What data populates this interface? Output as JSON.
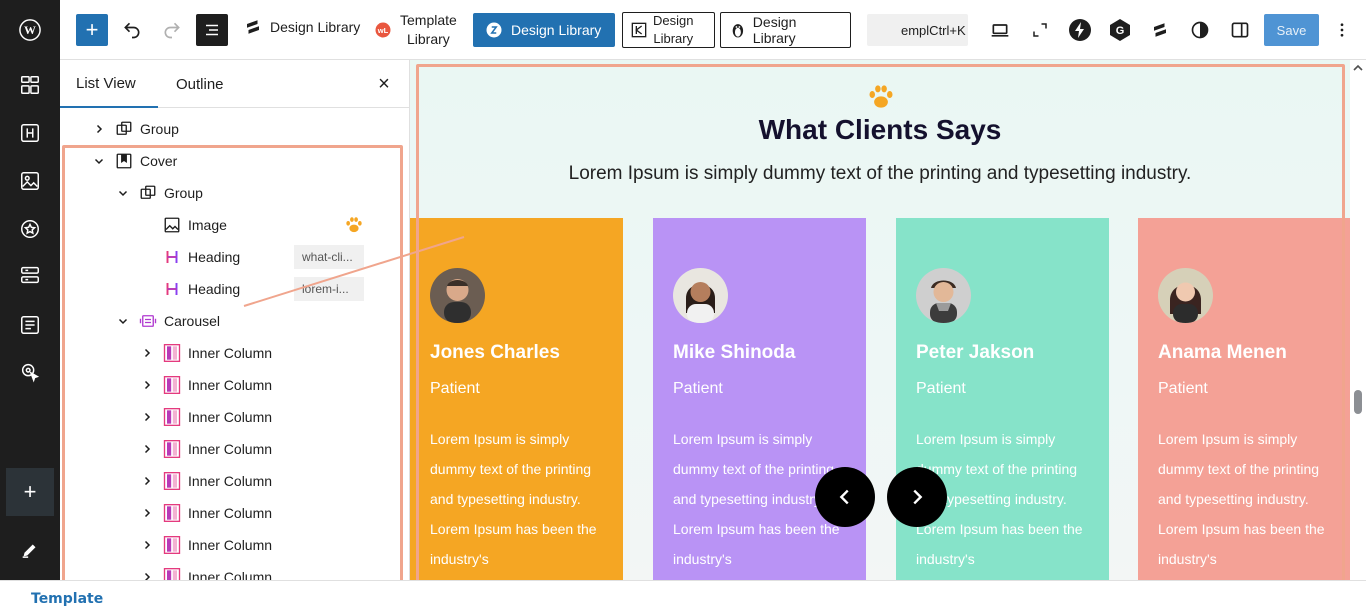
{
  "toolbar": {
    "plugin_1": "Design Library",
    "plugin_2_line1": "Template",
    "plugin_2_line2": "Library",
    "plugin_3": "Design Library",
    "plugin_4_line1": "Design",
    "plugin_4_line2": "Library",
    "plugin_5": "Design Library",
    "search_text": "emplCtrl+K",
    "save_label": "Save"
  },
  "panel": {
    "tabs": [
      "List View",
      "Outline"
    ],
    "close_icon": "close-icon",
    "tree": [
      {
        "label": "Group",
        "icon": "group-icon",
        "depth": 0,
        "chevron": "right"
      },
      {
        "label": "Cover",
        "icon": "cover-icon",
        "depth": 0,
        "chevron": "down"
      },
      {
        "label": "Group",
        "icon": "group-icon",
        "depth": 1,
        "chevron": "down"
      },
      {
        "label": "Image",
        "icon": "image-icon",
        "depth": 2,
        "chevron": "none"
      },
      {
        "label": "Heading",
        "icon": "heading-icon",
        "depth": 2,
        "chevron": "none",
        "anchor": "what-cli..."
      },
      {
        "label": "Heading",
        "icon": "heading-icon",
        "depth": 2,
        "chevron": "none",
        "anchor": "lorem-i..."
      },
      {
        "label": "Carousel",
        "icon": "carousel-icon",
        "depth": 1,
        "chevron": "down"
      },
      {
        "label": "Inner Column",
        "icon": "column-icon",
        "depth": 2,
        "chevron": "right"
      },
      {
        "label": "Inner Column",
        "icon": "column-icon",
        "depth": 2,
        "chevron": "right"
      },
      {
        "label": "Inner Column",
        "icon": "column-icon",
        "depth": 2,
        "chevron": "right"
      },
      {
        "label": "Inner Column",
        "icon": "column-icon",
        "depth": 2,
        "chevron": "right"
      },
      {
        "label": "Inner Column",
        "icon": "column-icon",
        "depth": 2,
        "chevron": "right"
      },
      {
        "label": "Inner Column",
        "icon": "column-icon",
        "depth": 2,
        "chevron": "right"
      },
      {
        "label": "Inner Column",
        "icon": "column-icon",
        "depth": 2,
        "chevron": "right"
      },
      {
        "label": "Inner Column",
        "icon": "column-icon",
        "depth": 2,
        "chevron": "right"
      }
    ]
  },
  "canvas": {
    "title": "What Clients Says",
    "subtitle": "Lorem Ipsum is simply dummy text of the printing and typesetting industry.",
    "cards": [
      {
        "name": "Jones Charles",
        "role": "Patient",
        "text": "Lorem Ipsum is simply dummy text of the printing and typesetting industry. Lorem Ipsum has been the industry's",
        "color": "#f5a623"
      },
      {
        "name": "Mike Shinoda",
        "role": "Patient",
        "text": "Lorem Ipsum is simply dummy text of the printing and typesetting industry. Lorem Ipsum has been the industry's",
        "color": "#b993f5"
      },
      {
        "name": "Peter Jakson",
        "role": "Patient",
        "text": "Lorem Ipsum is simply dummy text of the printing and typesetting industry. Lorem Ipsum has been the industry's",
        "color": "#86e3c9"
      },
      {
        "name": "Anama Menen",
        "role": "Patient",
        "text": "Lorem Ipsum is simply dummy text of the printing and typesetting industry. Lorem Ipsum has been the industry's",
        "color": "#f4a196"
      }
    ],
    "prev_icon": "chevron-left-icon",
    "next_icon": "chevron-right-icon"
  },
  "colors": {
    "accent": "#2271b1",
    "highlight": "#f0a58d",
    "paw": "#f5a623"
  },
  "footer": {
    "label": "Template"
  }
}
